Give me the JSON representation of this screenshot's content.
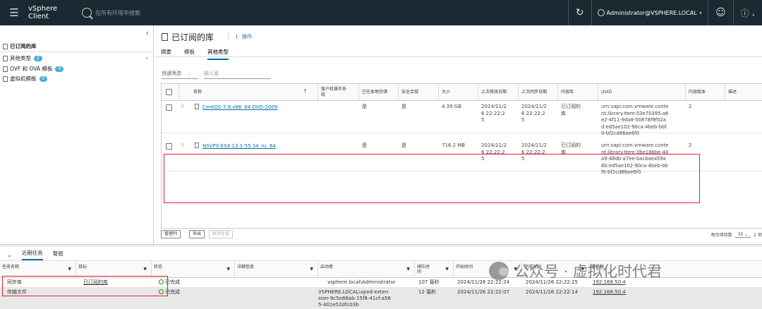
{
  "topbar": {
    "app_title": "vSphere Client",
    "search_placeholder": "在所有环境中搜索",
    "user": "Administrator@VSPHERE.LOCAL",
    "user_caret": "∨",
    "help_caret": "∨"
  },
  "left": {
    "title": "已订阅的库",
    "items": [
      {
        "label": "其他类型",
        "count": "2"
      },
      {
        "label": "OVF 和 OVA 模板",
        "count": "0"
      },
      {
        "label": "虚拟机模板",
        "count": "0"
      }
    ]
  },
  "main": {
    "title": "已订阅的库",
    "actions": "操作",
    "tabs": [
      "摘要",
      "模板",
      "其他类型"
    ],
    "quick_filter": "快速筛选",
    "filter_placeholder": "输入值",
    "columns": [
      "名称",
      "客户机操作系统",
      "已在本地存储",
      "安全合规",
      "大小",
      "上次修改日期",
      "上次同步日期",
      "内容库",
      "UUID",
      "内容版本",
      "描述"
    ],
    "rows": [
      {
        "name": "CentOS-7.9-x86_64-DVD-2009",
        "guest_os": "",
        "stored_locally": "是",
        "compliance": "是",
        "size": "4.39 GB",
        "modified": [
          "2024/11/2",
          "6 22:22:2",
          "5"
        ],
        "synced": [
          "2024/11/2",
          "6 22:22:2",
          "5"
        ],
        "library": [
          "已订阅的",
          "库"
        ],
        "uuid": [
          "urn:vapi:com.vmware.conte",
          "nt.library.Item:03e70395-a6",
          "e2-4f11-9da8-50878f9f02a",
          "d:ed5ae102-90ca-4beb-bbf",
          "0-bf2cd86ae6f0"
        ],
        "version": "2",
        "description": ""
      },
      {
        "name": "NSVPX-ESX-13.1-55.34_nc_64",
        "guest_os": "",
        "stored_locally": "是",
        "compliance": "是",
        "size": "716.2 MB",
        "modified": [
          "2024/11/2",
          "6 22:22:2",
          "5"
        ],
        "synced": [
          "2024/11/2",
          "6 22:22:2",
          "5"
        ],
        "library": [
          "已订阅的",
          "库"
        ],
        "uuid": [
          "urn:vapi:com.vmware.conte",
          "nt.library.Item:3be18bbe-40",
          "a9-48db-a7ee-bacbaea59a",
          "8b:ed5ae102-90ca-4beb-bb",
          "f0-bf2cd86ae6f0"
        ],
        "version": "2",
        "description": ""
      }
    ],
    "footer": {
      "manage_columns": "管理列",
      "export": "导出",
      "deselect_all": "取消全选",
      "per_page_label": "每页项目数",
      "per_page": "35",
      "item_count": "2 项"
    }
  },
  "bottom": {
    "tabs": [
      "近期任务",
      "警报"
    ],
    "columns": [
      "任务名称",
      "目标",
      "状态",
      "详细信息",
      "启动者",
      "排队时间",
      "开始时间",
      "完成时间",
      "服务器"
    ],
    "tasks": [
      {
        "name": "同步库",
        "target": "已订阅的库",
        "status": "已完成",
        "details": "",
        "initiator": [
          "vsphere.local\\Administrator"
        ],
        "queued": "107 毫秒",
        "start": "2024/11/26 22:22:24",
        "end": "2024/11/26 22:22:25",
        "server": "192.168.50.4"
      },
      {
        "name": "传输文件",
        "target": "",
        "status": "已完成",
        "details": "",
        "initiator": [
          "VSPHERE.LOCAL\\vpxd-exten",
          "sion-9c5e88ab-15f8-41cf-a56",
          "5-401e52dfc03b"
        ],
        "queued": "12 毫秒",
        "start": "2024/11/26 22:22:07",
        "end": "2024/11/26 22:22:14",
        "server": "192.168.50.4"
      }
    ]
  },
  "watermark": "公众号 · 虚拟化时代君"
}
